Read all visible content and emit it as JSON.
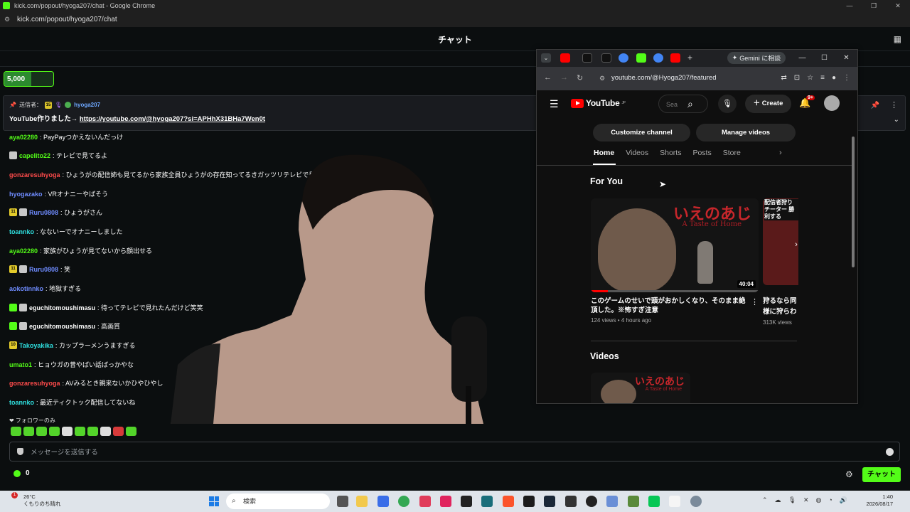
{
  "outer_window": {
    "title": "kick.com/popout/hyoga207/chat - Google Chrome",
    "url": "kick.com/popout/hyoga207/chat",
    "controls": [
      "—",
      "❐",
      "✕"
    ]
  },
  "kick": {
    "header_title": "チャット",
    "goal_value": "5,000",
    "pinned": {
      "label": "送信者：",
      "sub_badge": "15",
      "username": "hyoga207",
      "text_prefix": "YouTube作りました→ ",
      "link": "https://youtube.com/@hyoga207?si=APHhX31BHa7Wen0t"
    },
    "messages": [
      {
        "user": "aya02280",
        "color": "#53fc18",
        "text": ": PayPayつかえないんだっけ",
        "badges": []
      },
      {
        "user": "capelito22",
        "color": "#53fc18",
        "text": ": テレビで見てるよ",
        "badges": [
          "avatar"
        ]
      },
      {
        "user": "gonzaresuhyoga",
        "color": "#ff4b4b",
        "text": ": ひょうがの配信姉も見てるから家族全員ひょうがの存在知ってるきガッツリテレビで見",
        "badges": []
      },
      {
        "user": "hyogazako",
        "color": "#6f8cff",
        "text": ": VRオナニーやばそう",
        "badges": []
      },
      {
        "user": "Ruru0808",
        "color": "#6f8cff",
        "text": ": ひょうがさん",
        "badges": [
          "11",
          "avatar"
        ]
      },
      {
        "user": "toannko",
        "color": "#2fe0e0",
        "text": ": なないーでオナニーしました",
        "badges": []
      },
      {
        "user": "aya02280",
        "color": "#53fc18",
        "text": ": 家族がひょうが見てないから顔出せる",
        "badges": []
      },
      {
        "user": "Ruru0808",
        "color": "#6f8cff",
        "text": ": 笑",
        "badges": [
          "11",
          "avatar"
        ]
      },
      {
        "user": "aokotinnko",
        "color": "#6f8cff",
        "text": ": 地獄すぎる",
        "badges": []
      },
      {
        "user": "eguchitomoushimasu",
        "color": "#ffffff",
        "text": ": 待ってテレビで見れたんだけど笑笑",
        "badges": [
          "green",
          "avatar"
        ]
      },
      {
        "user": "eguchitomoushimasu",
        "color": "#ffffff",
        "text": ": 高画質",
        "badges": [
          "green",
          "avatar"
        ]
      },
      {
        "user": "Takoyakika",
        "color": "#2fe0e0",
        "text": ": カップラーメンうますぎる",
        "badges": [
          "10"
        ]
      },
      {
        "user": "umato1",
        "color": "#53fc18",
        "text": ": ヒョウガの昔やばい話ばっかやな",
        "badges": []
      },
      {
        "user": "gonzaresuhyoga",
        "color": "#ff4b4b",
        "text": ": AVみるとき親来ないかひやひやし",
        "badges": []
      },
      {
        "user": "toannko",
        "color": "#2fe0e0",
        "text": ": 最近ティクトック配信してないね",
        "badges": []
      }
    ],
    "follower_only": "❤ フォロワーのみ",
    "input_placeholder": "メッセージを送信する",
    "points": "0",
    "chat_button": "チャット"
  },
  "popup": {
    "gemini": "Gemini に相談",
    "url": "youtube.com/@Hyoga207/featured",
    "yt": {
      "logo": "YouTube",
      "logo_region": "JP",
      "search_placeholder": "Sea",
      "create": "Create",
      "notif_count": "9+",
      "customize": "Customize channel",
      "manage": "Manage videos",
      "tabs": [
        "Home",
        "Videos",
        "Shorts",
        "Posts",
        "Store"
      ],
      "for_you": "For You",
      "video1": {
        "thumb_title": "いえのあじ",
        "thumb_sub": "A Taste of Home",
        "duration": "40:04",
        "progress": 0.1,
        "title": "このゲームのせいで頭がおかしくなり、そのまま絶頂した。※怖すぎ注意",
        "meta": "124 views • 4 hours ago"
      },
      "video2": {
        "thumb_text": "配信者狩り チーター 勝利する",
        "title_line1": "狩るなら同",
        "title_line2": "様に狩らわ",
        "meta": "313K views"
      },
      "videos_heading": "Videos",
      "video3_thumb_title": "いえのあじ",
      "video3_thumb_sub": "A Taste of Home"
    }
  },
  "taskbar": {
    "weather_temp": "26°C",
    "weather_text": "くもりのち晴れ",
    "weather_badge": "1",
    "search": "検索",
    "time": "1:40",
    "date": "2026/08/17"
  }
}
